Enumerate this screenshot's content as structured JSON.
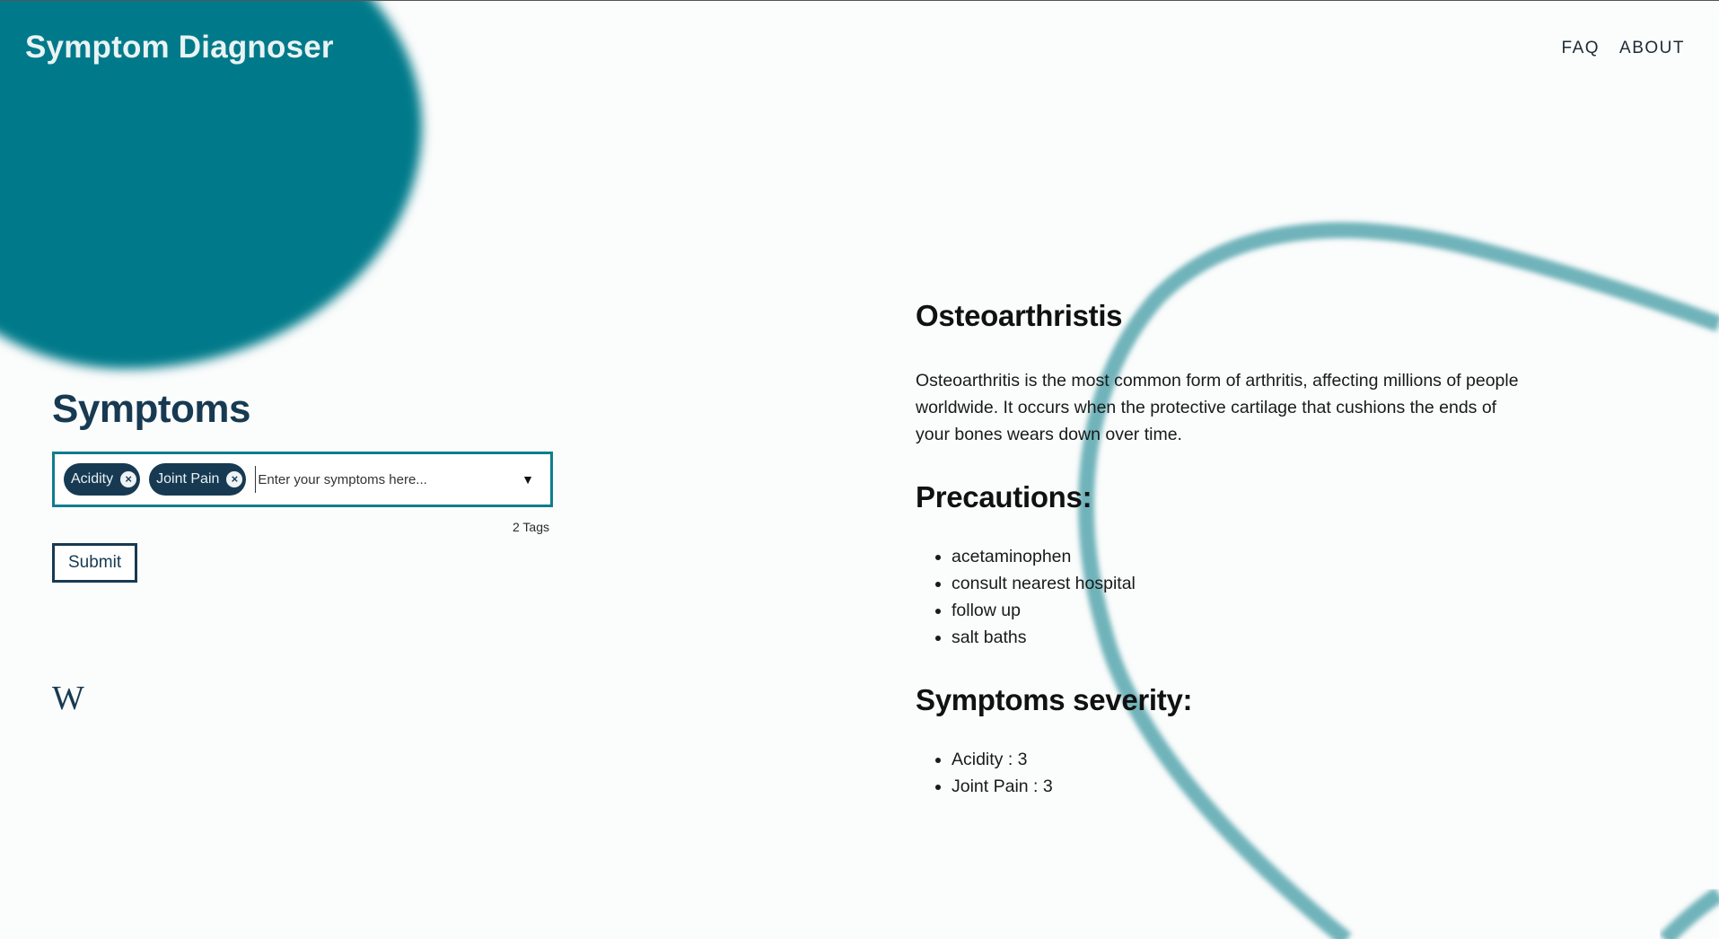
{
  "header": {
    "app_title": "Symptom Diagnoser",
    "nav": [
      "FAQ",
      "ABOUT"
    ]
  },
  "symptoms_panel": {
    "title": "Symptoms",
    "tags": [
      "Acidity",
      "Joint Pain"
    ],
    "tag_remove_glyph": "×",
    "input_placeholder": "Enter your symptoms here...",
    "dropdown_glyph": "▼",
    "tag_count": "2 Tags",
    "submit_label": "Submit",
    "wiki_glyph": "W"
  },
  "result": {
    "disease": "Osteoarthristis",
    "description": "Osteoarthritis is the most common form of arthritis, affecting millions of people worldwide. It occurs when the protective cartilage that cushions the ends of your bones wears down over time.",
    "precautions_title": "Precautions:",
    "precautions": [
      "acetaminophen",
      "consult nearest hospital",
      "follow up",
      "salt baths"
    ],
    "severity_title": "Symptoms severity:",
    "severity": [
      "Acidity : 3",
      "Joint Pain : 3"
    ]
  },
  "colors": {
    "accent_teal": "#007a8a",
    "navy": "#173a52",
    "ring": "#6fb3ba",
    "background": "#fbfcfc"
  }
}
